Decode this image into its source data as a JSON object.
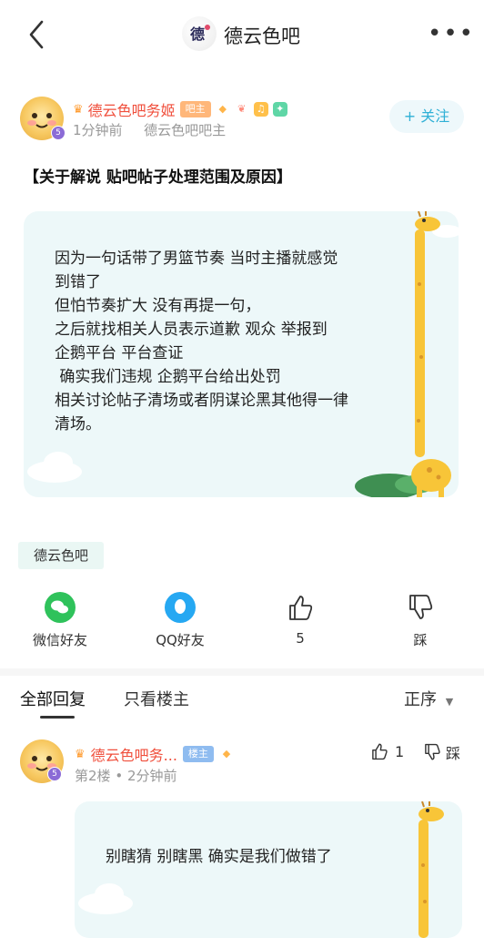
{
  "header": {
    "forum_name": "德云色吧",
    "more_icon": "more-dots-icon",
    "back_icon": "back-arrow-icon"
  },
  "post": {
    "author": "德云色吧务姬",
    "author_badge": "吧主",
    "time": "1分钟前",
    "author_role": "德云色吧吧主",
    "follow_label": "+ 关注",
    "title": "【关于解说 贴吧帖子处理范围及原因】",
    "body": "因为一句话带了男篮节奏 当时主播就感觉\n到错了\n但怕节奏扩大 没有再提一句，\n之后就找相关人员表示道歉 观众 举报到\n企鹅平台 平台查证\n 确实我们违规 企鹅平台给出处罚\n相关讨论帖子清场或者阴谋论黑其他得一律\n清场。",
    "forum_tag": "德云色吧"
  },
  "share": {
    "wechat_label": "微信好友",
    "qq_label": "QQ好友",
    "like_count": "5",
    "dislike_label": "踩"
  },
  "reply_tabs": {
    "all": "全部回复",
    "owner_only": "只看楼主",
    "order": "正序"
  },
  "reply": {
    "author": "德云色吧务...",
    "badge": "楼主",
    "floor": "第2楼",
    "time": "2分钟前",
    "like_count": "1",
    "dislike_label": "踩",
    "body": "别瞎猜 别瞎黑 确实是我们做错了"
  },
  "colors": {
    "accent": "#2fb0d6",
    "username": "#f04f3c",
    "card_bg": "#edf8f9"
  }
}
